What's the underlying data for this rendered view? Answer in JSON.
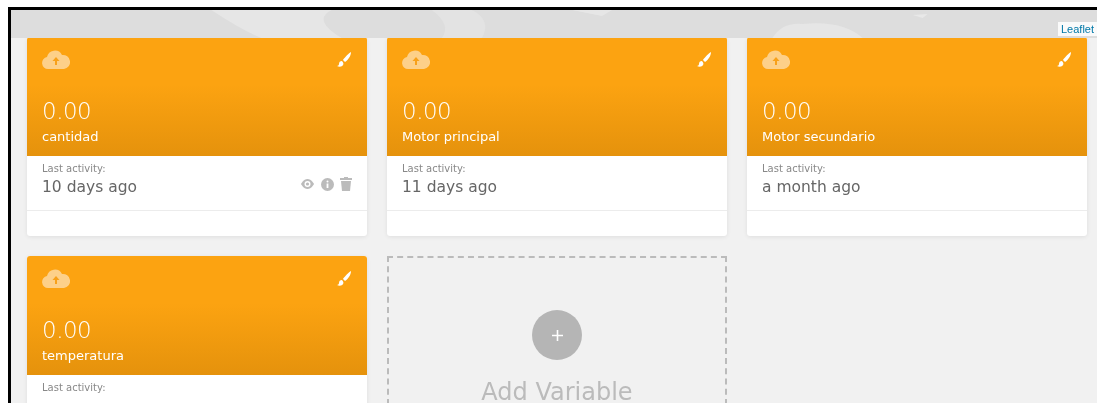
{
  "map": {
    "attribution": "Leaflet"
  },
  "variables": [
    {
      "value": "0.00",
      "name": "cantidad",
      "activity_label": "Last activity:",
      "activity": "10 days ago",
      "show_actions": true
    },
    {
      "value": "0.00",
      "name": "Motor principal",
      "activity_label": "Last activity:",
      "activity": "11 days ago",
      "show_actions": false
    },
    {
      "value": "0.00",
      "name": "Motor secundario",
      "activity_label": "Last activity:",
      "activity": "a month ago",
      "show_actions": false
    },
    {
      "value": "0.00",
      "name": "temperatura",
      "activity_label": "Last activity:"
    }
  ],
  "add_tile": {
    "label": "Add Variable"
  }
}
